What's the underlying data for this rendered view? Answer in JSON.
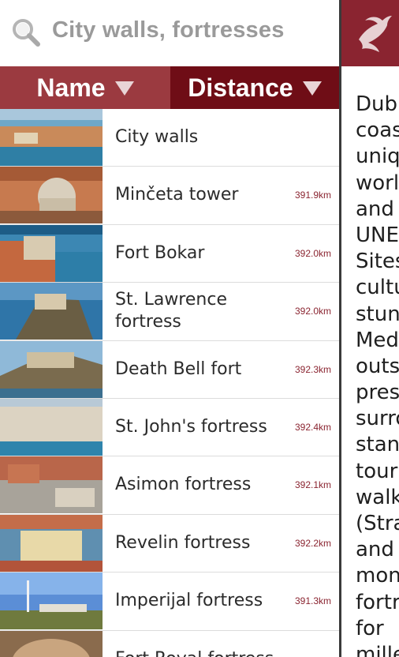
{
  "search": {
    "title": "City walls, fortresses"
  },
  "sort": {
    "name_label": "Name",
    "distance_label": "Distance"
  },
  "items": [
    {
      "name": "City walls",
      "distance": ""
    },
    {
      "name": "Minčeta tower",
      "distance": "391.9km"
    },
    {
      "name": "Fort Bokar",
      "distance": "392.0km"
    },
    {
      "name": "St. Lawrence fortress",
      "distance": "392.0km"
    },
    {
      "name": "Death Bell fort",
      "distance": "392.3km"
    },
    {
      "name": "St. John's fortress",
      "distance": "392.4km"
    },
    {
      "name": "Asimon fortress",
      "distance": "392.1km"
    },
    {
      "name": "Revelin fortress",
      "distance": "392.2km"
    },
    {
      "name": "Imperijal fortress",
      "distance": "391.3km"
    },
    {
      "name": "Fort Royal fortress",
      "distance": ""
    }
  ],
  "detail": {
    "lines": [
      "Dub",
      "coas",
      "uniq",
      "worl",
      "and",
      "UNE",
      "Sites",
      "cultu",
      "stun",
      "Med",
      "outs",
      "pres",
      "surro",
      "stanc",
      "touri",
      "walk",
      "(Stra",
      "and",
      "mon",
      "fortr",
      "for",
      "mille"
    ]
  },
  "colors": {
    "accent": "#7c1a22",
    "tab_active": "#9b3a40",
    "tab_inactive": "#6f0d16",
    "distance": "#8a2430"
  },
  "icons": {
    "search": "search-icon",
    "logo": "bird-logo-icon",
    "sort": "sort-triangle-icon"
  }
}
